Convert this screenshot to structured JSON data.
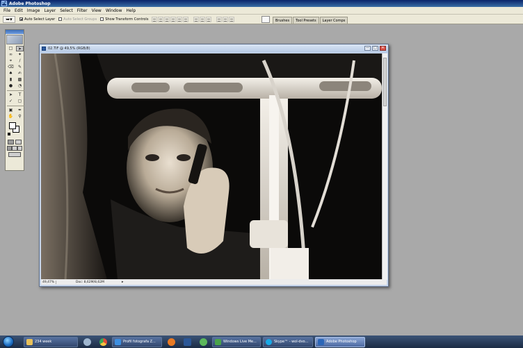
{
  "app": {
    "title": "Adobe Photoshop"
  },
  "menu": [
    "File",
    "Edit",
    "Image",
    "Layer",
    "Select",
    "Filter",
    "View",
    "Window",
    "Help"
  ],
  "options": {
    "auto_select_layer": "Auto Select Layer",
    "auto_select_groups": "Auto Select Groups",
    "show_transform_controls": "Show Transform Controls"
  },
  "palette_tabs": [
    "Brushes",
    "Tool Presets",
    "Layer Comps"
  ],
  "document": {
    "title": "02.TIF @ 49,5% (RGB/8)",
    "zoom": "49,47%",
    "doc_size": "Doc: 8,62M/8,62M"
  },
  "taskbar": {
    "items": [
      {
        "label": "234 week",
        "icon": "folder-icon",
        "color": "#e8c15a"
      },
      {
        "label": "",
        "icon": "settings-icon",
        "color": "#9fb6cf"
      },
      {
        "label": "",
        "icon": "chrome-icon",
        "color": "#e04b3a"
      },
      {
        "label": "Profil fotografa Z...",
        "icon": "ie-icon",
        "color": "#3d8fe0"
      },
      {
        "label": "",
        "icon": "firefox-icon",
        "color": "#e97a24"
      },
      {
        "label": "",
        "icon": "word-icon",
        "color": "#2b5797"
      },
      {
        "label": "",
        "icon": "media-icon",
        "color": "#5cb85c"
      },
      {
        "label": "Windows Live Me...",
        "icon": "messenger-icon",
        "color": "#4aa34a"
      },
      {
        "label": "Skype™ - wol-dvo...",
        "icon": "skype-icon",
        "color": "#19a9e5"
      },
      {
        "label": "Adobe Photoshop",
        "icon": "photoshop-icon",
        "color": "#2b66b8",
        "active": true
      }
    ]
  }
}
